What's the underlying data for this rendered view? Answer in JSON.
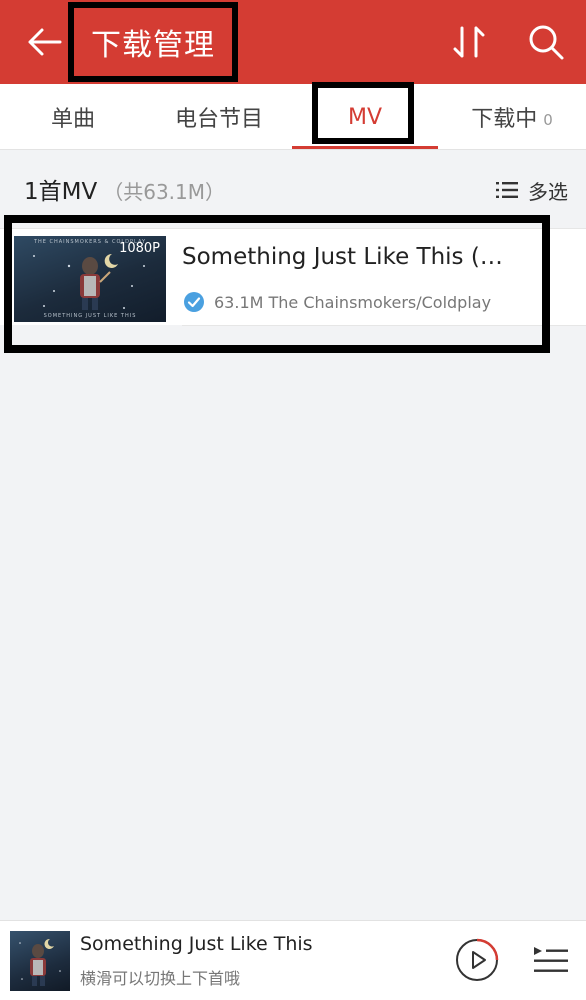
{
  "header": {
    "title": "下载管理",
    "background_color": "#d43c33",
    "icons": {
      "back": "arrow-left-icon",
      "sort": "sort-icon",
      "search": "search-icon"
    }
  },
  "tabs": [
    {
      "label": "单曲",
      "active": false
    },
    {
      "label": "电台节目",
      "active": false
    },
    {
      "label": "MV",
      "active": true
    },
    {
      "label": "下载中",
      "badge": "0",
      "active": false
    }
  ],
  "summary": {
    "count_label": "1首MV",
    "size_label": "（共63.1M）",
    "multi_select_label": "多选"
  },
  "items": [
    {
      "title": "Something Just Like This (…",
      "resolution": "1080P",
      "subtitle": "63.1M The Chainsmokers/Coldplay",
      "status_icon": "downloaded-check-icon",
      "thumb_top_text": "THE CHAINSMOKERS & COLDPLAY",
      "thumb_bottom_text": "SOMETHING JUST LIKE THIS"
    }
  ],
  "player": {
    "title": "Something Just Like This",
    "subtitle": "横滑可以切换上下首哦",
    "icons": {
      "play": "play-circle-icon",
      "playlist": "playlist-icon"
    }
  }
}
